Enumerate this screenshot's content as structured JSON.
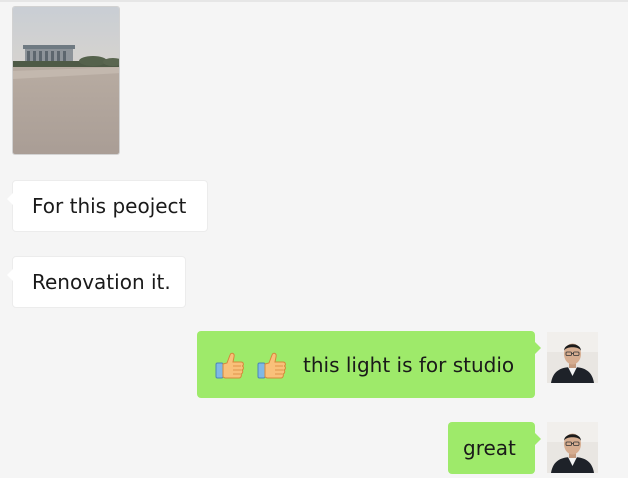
{
  "chat": {
    "messages": [
      {
        "sender": "contact",
        "type": "image",
        "icon": "building-photo"
      },
      {
        "sender": "contact",
        "type": "text",
        "text": "For this peoject"
      },
      {
        "sender": "contact",
        "type": "text",
        "text": "Renovation it."
      },
      {
        "sender": "self",
        "type": "text",
        "emoji": [
          "thumbs-up",
          "thumbs-up"
        ],
        "text": "this light is for studio"
      },
      {
        "sender": "self",
        "type": "text",
        "text": "great"
      }
    ]
  },
  "colors": {
    "background": "#f5f5f5",
    "bubble_self": "#9eea6a",
    "bubble_contact": "#ffffff"
  }
}
